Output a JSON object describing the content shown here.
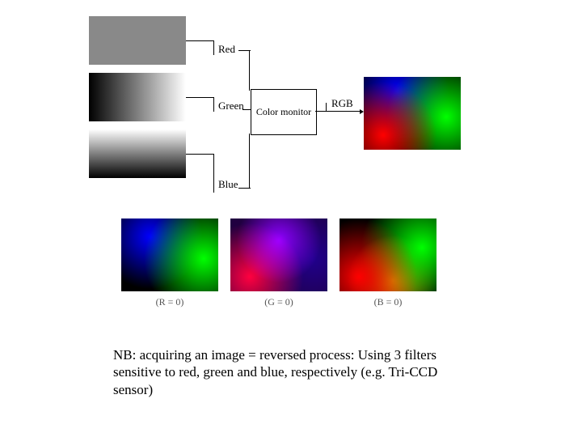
{
  "labels": {
    "red": "Red",
    "green": "Green",
    "blue": "Blue",
    "monitor": "Color monitor",
    "rgb": "RGB"
  },
  "panels": {
    "r0": "(R = 0)",
    "g0": "(G = 0)",
    "b0": "(B = 0)"
  },
  "note": "NB: acquiring an image = reversed process: Using 3 filters sensitive to red, green and blue, respectively (e.g. Tri-CCD sensor)"
}
